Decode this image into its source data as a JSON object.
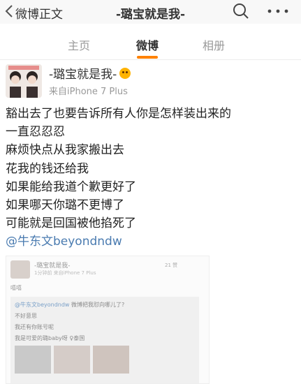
{
  "nav": {
    "back_label": "微博正文",
    "title": "-璐宝就是我-",
    "icons": [
      "chevron-left-icon",
      "search-icon",
      "more-icon"
    ]
  },
  "tabs": [
    {
      "label": "主页",
      "active": false
    },
    {
      "label": "微博",
      "active": true
    },
    {
      "label": "相册",
      "active": false
    }
  ],
  "post": {
    "author": "-璐宝就是我-",
    "source": "来自iPhone 7 Plus",
    "lines": [
      "豁出去了也要告诉所有人你是怎样装出来的",
      "一直忍忍忍",
      "麻烦快点从我家搬出去",
      "花我的钱还给我",
      "如果能给我道个歉更好了",
      "如果哪天你璐不更博了",
      "可能就是回国被他掐死了"
    ],
    "mention": "@牛东文beyondndw"
  },
  "embedded": {
    "author": "-璐宝就是我-",
    "source": "1分钟前 来自iPhone 7 Plus",
    "likes": "21 赞",
    "blurred": "嘻嘻",
    "repost_lines": [
      {
        "mention": "@牛东文beyondndw",
        "text": "微博把我怼向哪儿了?"
      },
      {
        "mention": "",
        "text": "不好意思"
      },
      {
        "mention": "",
        "text": "我还有你账号呢"
      },
      {
        "mention": "",
        "text": "我是可爱的璐baby呀 ♀泰国"
      }
    ]
  },
  "colors": {
    "accent_orange": "#ff8200",
    "link_blue": "#4a7bb0",
    "text": "#222222",
    "muted": "#999999"
  }
}
